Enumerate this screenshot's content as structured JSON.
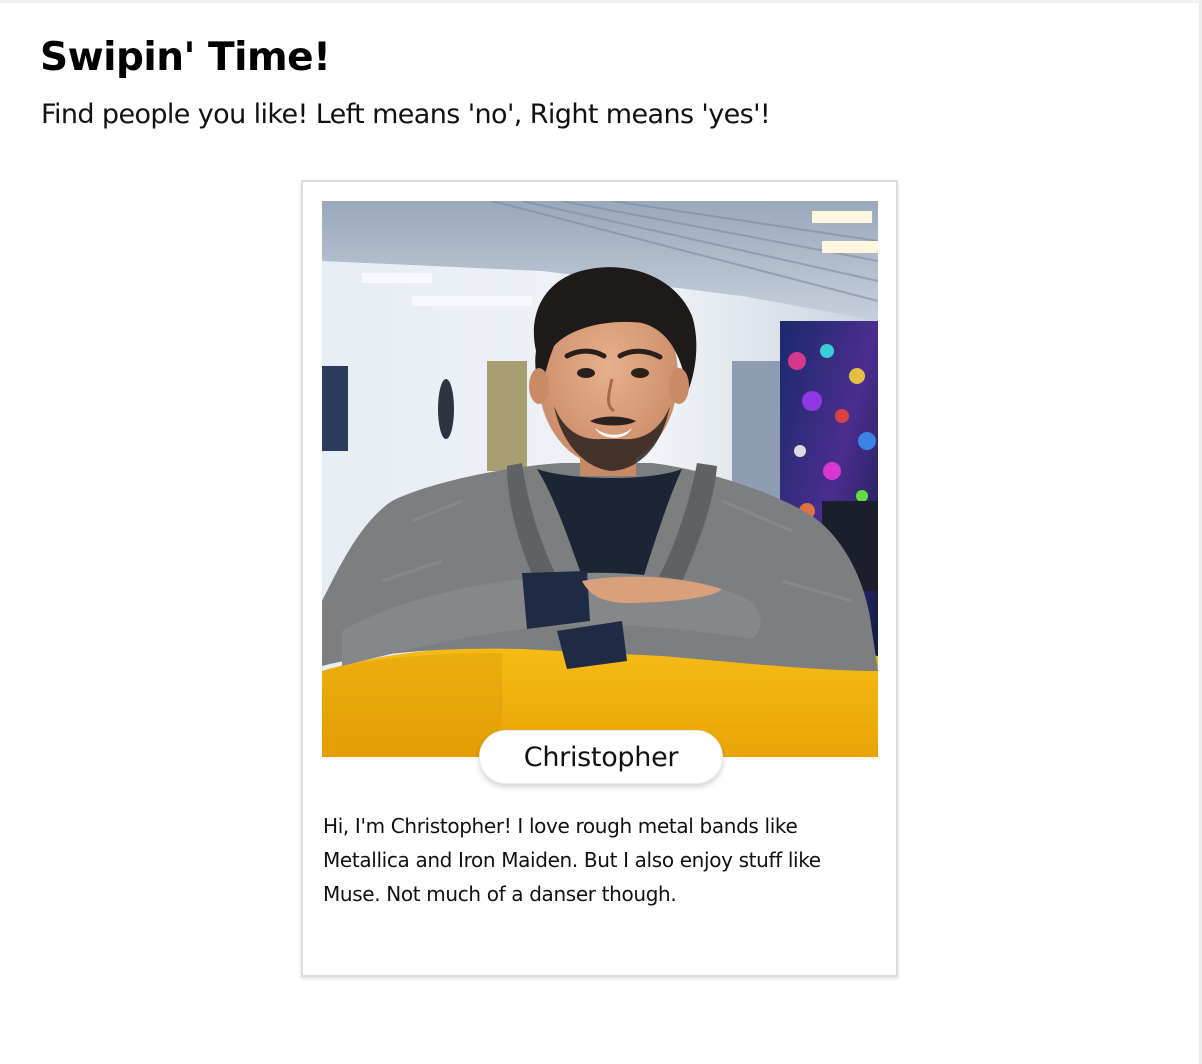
{
  "header": {
    "title": "Swipin' Time!",
    "subtitle": "Find people you like! Left means 'no', Right means 'yes'!"
  },
  "profile": {
    "name": "Christopher",
    "bio": "Hi, I'm Christopher! I love rough metal bands like Metallica and Iron Maiden. But I also enjoy stuff like Muse. Not much of a danser though.",
    "photo_label": "profile-photo"
  },
  "colors": {
    "sofa_yellow": "#f3b30f",
    "wall": "#dfe6ef",
    "hoodie": "#7d7f80",
    "hoodie_cuff": "#1f2a44"
  }
}
